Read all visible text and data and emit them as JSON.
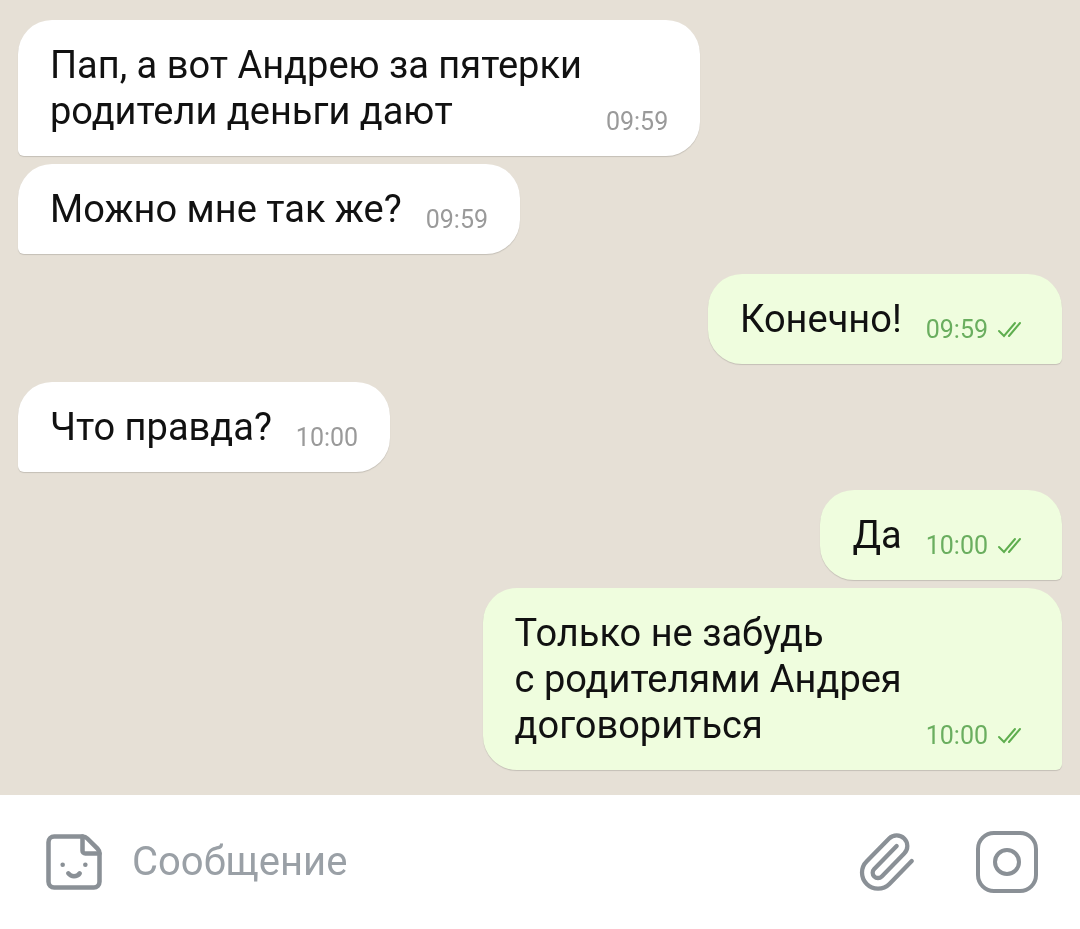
{
  "messages": [
    {
      "kind": "incoming",
      "text": "Пап, а вот Андрею за пятерки\nродители деньги дают",
      "time": "09:59"
    },
    {
      "kind": "incoming",
      "text": "Можно мне так же?",
      "time": "09:59"
    },
    {
      "kind": "outgoing",
      "text": "Конечно!",
      "time": "09:59",
      "read": true
    },
    {
      "kind": "incoming",
      "text": "Что правда?",
      "time": "10:00"
    },
    {
      "kind": "outgoing",
      "text": "Да",
      "time": "10:00",
      "read": true
    },
    {
      "kind": "outgoing",
      "text": "Только не забудь\nс родителями Андрея\nдоговориться",
      "time": "10:00",
      "read": true
    }
  ],
  "composer": {
    "placeholder": "Сообщение"
  }
}
